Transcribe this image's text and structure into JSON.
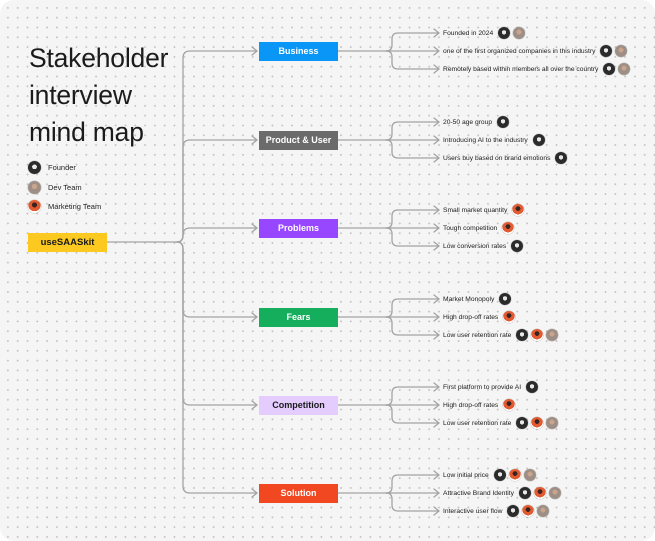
{
  "title": "Stakeholder interview mind map",
  "title_lines": [
    "Stakeholder",
    "interview",
    "mind map"
  ],
  "legend": [
    {
      "avatar": "founder",
      "label": "Founder"
    },
    {
      "avatar": "dev",
      "label": "Dev Team"
    },
    {
      "avatar": "marketing",
      "label": "Marketing Team"
    }
  ],
  "root": {
    "label": "useSAASkit",
    "color": "#FBC91F"
  },
  "branches": [
    {
      "label": "Business",
      "color": "#0A96F7",
      "text_color": "#FFFFFF",
      "leaves": [
        {
          "text": "Founded in 2024",
          "avatars": [
            "founder",
            "dev"
          ]
        },
        {
          "text": "one of the first organized companies in this industry",
          "avatars": [
            "founder",
            "dev"
          ]
        },
        {
          "text": "Remotely based within members all over the country",
          "avatars": [
            "founder",
            "dev"
          ]
        }
      ]
    },
    {
      "label": "Product & User",
      "color": "#6B6B6B",
      "text_color": "#FFFFFF",
      "leaves": [
        {
          "text": "20-50 age group",
          "avatars": [
            "founder"
          ]
        },
        {
          "text": "Introducing AI to the industry",
          "avatars": [
            "founder"
          ]
        },
        {
          "text": "Users buy based on brand emotions",
          "avatars": [
            "founder"
          ]
        }
      ]
    },
    {
      "label": "Problems",
      "color": "#9747FF",
      "text_color": "#FFFFFF",
      "leaves": [
        {
          "text": "Small market quantity",
          "avatars": [
            "marketing"
          ]
        },
        {
          "text": "Tough competition",
          "avatars": [
            "marketing"
          ]
        },
        {
          "text": "Low conversion rates",
          "avatars": [
            "founder"
          ]
        }
      ]
    },
    {
      "label": "Fears",
      "color": "#14AE5C",
      "text_color": "#FFFFFF",
      "leaves": [
        {
          "text": "Market Monopoly",
          "avatars": [
            "founder"
          ]
        },
        {
          "text": "High drop-off rates",
          "avatars": [
            "marketing"
          ]
        },
        {
          "text": "Low user retention rate",
          "avatars": [
            "founder",
            "marketing",
            "dev"
          ]
        }
      ]
    },
    {
      "label": "Competition",
      "color": "#E4CCFF",
      "text_color": "#1A1A1A",
      "leaves": [
        {
          "text": "First platform to provide AI",
          "avatars": [
            "founder"
          ]
        },
        {
          "text": "High drop-off rates",
          "avatars": [
            "marketing"
          ]
        },
        {
          "text": "Low user retention rate",
          "avatars": [
            "founder",
            "marketing",
            "dev"
          ]
        }
      ]
    },
    {
      "label": "Solution",
      "color": "#F24822",
      "text_color": "#FFFFFF",
      "leaves": [
        {
          "text": "Low initial price",
          "avatars": [
            "founder",
            "marketing",
            "dev"
          ]
        },
        {
          "text": "Attractive Brand Identity",
          "avatars": [
            "founder",
            "marketing",
            "dev"
          ]
        },
        {
          "text": "Interactive user flow",
          "avatars": [
            "founder",
            "marketing",
            "dev"
          ]
        }
      ]
    }
  ],
  "colors": {
    "connector": "#A3A3A3",
    "canvas": "#F5F5F5",
    "grid_dot": "#C4C4C4"
  }
}
